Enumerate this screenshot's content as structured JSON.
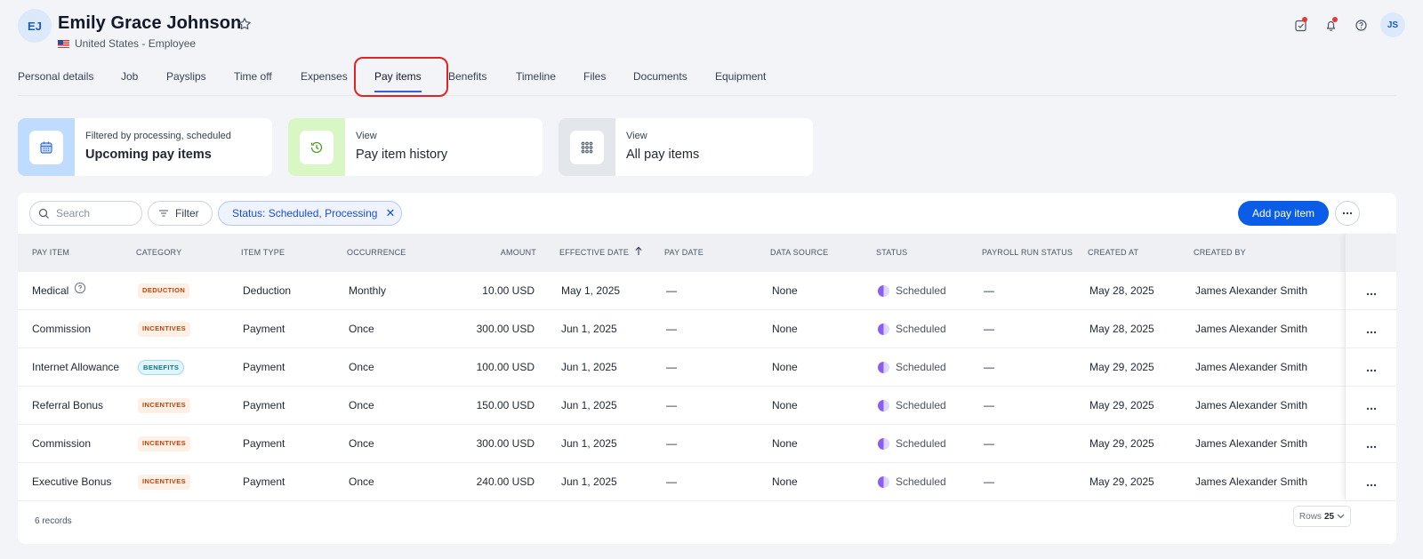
{
  "employee": {
    "initials": "EJ",
    "name": "Emily Grace Johnson",
    "subtitle": "United States - Employee"
  },
  "user": {
    "initials": "JS"
  },
  "tabs": [
    {
      "label": "Personal details"
    },
    {
      "label": "Job"
    },
    {
      "label": "Payslips"
    },
    {
      "label": "Time off"
    },
    {
      "label": "Expenses"
    },
    {
      "label": "Pay items",
      "active": true
    },
    {
      "label": "Benefits"
    },
    {
      "label": "Timeline"
    },
    {
      "label": "Files"
    },
    {
      "label": "Documents"
    },
    {
      "label": "Equipment"
    }
  ],
  "cards": [
    {
      "subtitle": "Filtered by processing, scheduled",
      "title": "Upcoming pay items",
      "icon": "calendar-icon",
      "color": "#bfdbfe"
    },
    {
      "subtitle": "View",
      "title": "Pay item history",
      "icon": "history-icon",
      "color": "#d9f7c4"
    },
    {
      "subtitle": "View",
      "title": "All pay items",
      "icon": "grid-icon",
      "color": "#e3e6eb"
    }
  ],
  "toolbar": {
    "search_placeholder": "Search",
    "filter_label": "Filter",
    "chip_label": "Status: Scheduled, Processing",
    "add_label": "Add pay item"
  },
  "table": {
    "columns": [
      "PAY ITEM",
      "CATEGORY",
      "ITEM TYPE",
      "OCCURRENCE",
      "AMOUNT",
      "EFFECTIVE DATE",
      "PAY DATE",
      "DATA SOURCE",
      "STATUS",
      "PAYROLL RUN STATUS",
      "CREATED AT",
      "CREATED BY"
    ],
    "rows": [
      {
        "pay_item": "Medical",
        "category": "DEDUCTION",
        "item_type": "Deduction",
        "occurrence": "Monthly",
        "amount": "10.00 USD",
        "effective_date": "May 1, 2025",
        "pay_date": "—",
        "data_source": "None",
        "status": "Scheduled",
        "payroll_run_status": "—",
        "created_at": "May 28, 2025",
        "created_by": "James Alexander Smith"
      },
      {
        "pay_item": "Commission",
        "category": "INCENTIVES",
        "item_type": "Payment",
        "occurrence": "Once",
        "amount": "300.00 USD",
        "effective_date": "Jun 1, 2025",
        "pay_date": "—",
        "data_source": "None",
        "status": "Scheduled",
        "payroll_run_status": "—",
        "created_at": "May 28, 2025",
        "created_by": "James Alexander Smith"
      },
      {
        "pay_item": "Internet Allowance",
        "category": "BENEFITS",
        "item_type": "Payment",
        "occurrence": "Once",
        "amount": "100.00 USD",
        "effective_date": "Jun 1, 2025",
        "pay_date": "—",
        "data_source": "None",
        "status": "Scheduled",
        "payroll_run_status": "—",
        "created_at": "May 29, 2025",
        "created_by": "James Alexander Smith"
      },
      {
        "pay_item": "Referral Bonus",
        "category": "INCENTIVES",
        "item_type": "Payment",
        "occurrence": "Once",
        "amount": "150.00 USD",
        "effective_date": "Jun 1, 2025",
        "pay_date": "—",
        "data_source": "None",
        "status": "Scheduled",
        "payroll_run_status": "—",
        "created_at": "May 29, 2025",
        "created_by": "James Alexander Smith"
      },
      {
        "pay_item": "Commission",
        "category": "INCENTIVES",
        "item_type": "Payment",
        "occurrence": "Once",
        "amount": "300.00 USD",
        "effective_date": "Jun 1, 2025",
        "pay_date": "—",
        "data_source": "None",
        "status": "Scheduled",
        "payroll_run_status": "—",
        "created_at": "May 29, 2025",
        "created_by": "James Alexander Smith"
      },
      {
        "pay_item": "Executive Bonus",
        "category": "INCENTIVES",
        "item_type": "Payment",
        "occurrence": "Once",
        "amount": "240.00 USD",
        "effective_date": "Jun 1, 2025",
        "pay_date": "—",
        "data_source": "None",
        "status": "Scheduled",
        "payroll_run_status": "—",
        "created_at": "May 29, 2025",
        "created_by": "James Alexander Smith"
      }
    ]
  },
  "footer": {
    "records": "6 records",
    "rows_label": "Rows",
    "rows_value": "25"
  }
}
